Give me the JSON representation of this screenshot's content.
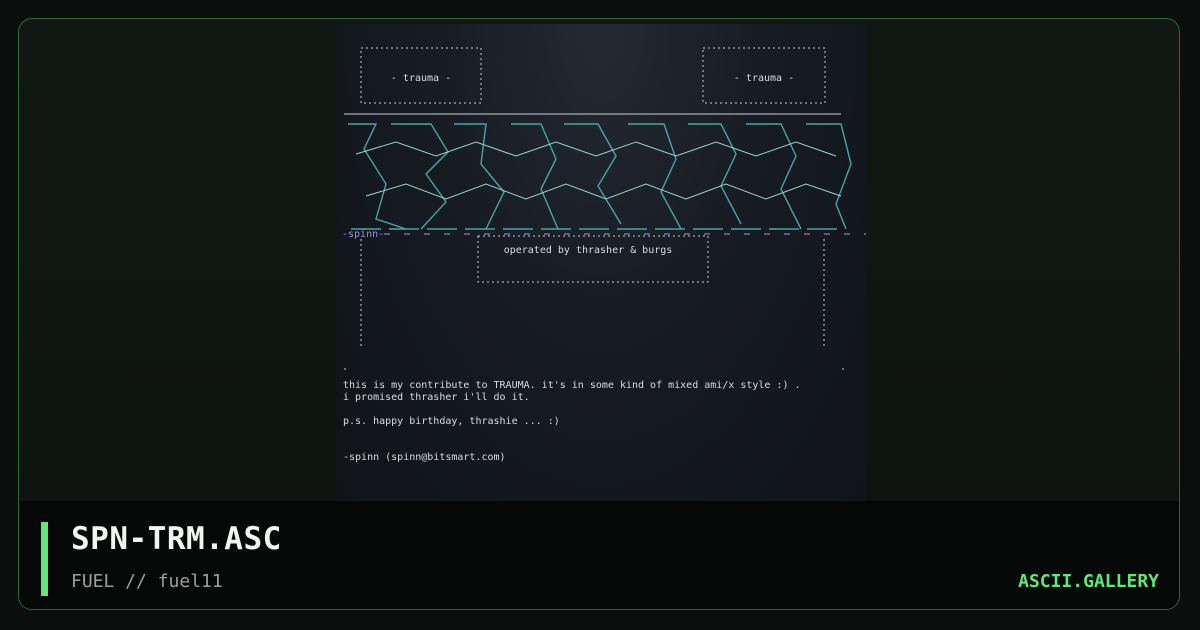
{
  "artwork": {
    "tag_left": "- trauma -",
    "tag_right": "- trauma -",
    "signature_tag": "-spinn-",
    "credit": "operated by thrasher & burgs",
    "text_lines": [
      "this is my contribute to TRAUMA. it's in some kind of mixed ami/x style :) .",
      "i promised thrasher i'll do it.",
      "",
      "p.s. happy birthday, thrashie ... :)",
      "",
      "",
      "-spinn (spinn@bitsmart.com)"
    ]
  },
  "footer": {
    "title": "SPN-TRM.ASC",
    "subtitle": "FUEL // fuel11",
    "brand": "ASCII.GALLERY"
  },
  "colors": {
    "accent": "#5ee878",
    "border": "#2a6b35",
    "logo": "#4aa3a6",
    "signature": "#a98de0"
  }
}
